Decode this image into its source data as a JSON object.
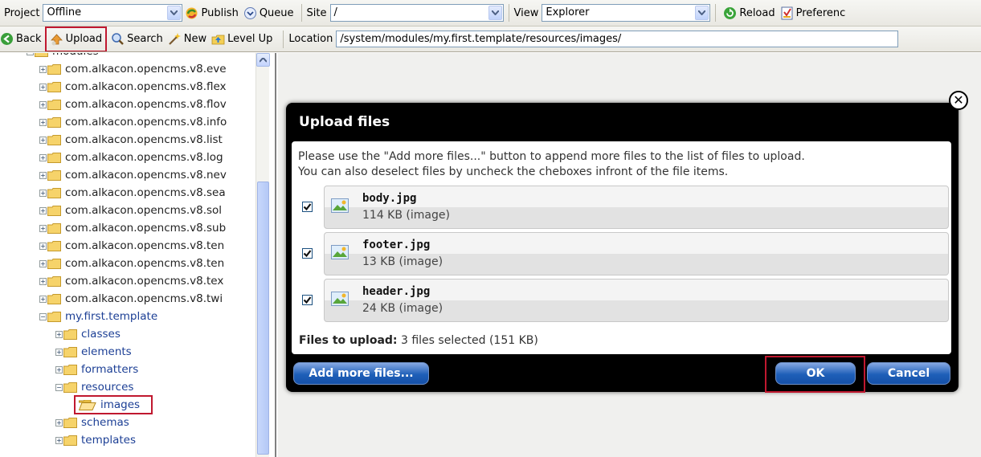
{
  "toolbar1": {
    "project_label": "Project",
    "project_value": "Offline",
    "publish_label": "Publish",
    "queue_label": "Queue",
    "site_label": "Site",
    "site_value": "/",
    "view_label": "View",
    "view_value": "Explorer",
    "reload_label": "Reload",
    "preferences_label": "Preferenc"
  },
  "toolbar2": {
    "back_label": "Back",
    "upload_label": "Upload",
    "search_label": "Search",
    "new_label": "New",
    "levelup_label": "Level Up",
    "location_label": "Location",
    "location_value": "/system/modules/my.first.template/resources/images/"
  },
  "tree": {
    "root": "modules",
    "modules": [
      "com.alkacon.opencms.v8.eve",
      "com.alkacon.opencms.v8.flex",
      "com.alkacon.opencms.v8.flov",
      "com.alkacon.opencms.v8.info",
      "com.alkacon.opencms.v8.list",
      "com.alkacon.opencms.v8.log",
      "com.alkacon.opencms.v8.nev",
      "com.alkacon.opencms.v8.sea",
      "com.alkacon.opencms.v8.sol",
      "com.alkacon.opencms.v8.sub",
      "com.alkacon.opencms.v8.ten",
      "com.alkacon.opencms.v8.ten",
      "com.alkacon.opencms.v8.tex",
      "com.alkacon.opencms.v8.twi"
    ],
    "template": "my.first.template",
    "template_children": [
      "classes",
      "elements",
      "formatters",
      "resources"
    ],
    "images": "images",
    "after_resources": [
      "schemas",
      "templates"
    ]
  },
  "dialog": {
    "title": "Upload files",
    "intro_line1": "Please use the \"Add more files...\" button to append more files to the list of files to upload.",
    "intro_line2": "You can also deselect files by uncheck the cheboxes infront of the file items.",
    "files": [
      {
        "name": "body.jpg",
        "meta": "114 KB (image)",
        "checked": true
      },
      {
        "name": "footer.jpg",
        "meta": "13 KB (image)",
        "checked": true
      },
      {
        "name": "header.jpg",
        "meta": "24 KB (image)",
        "checked": true
      }
    ],
    "summary_label": "Files to upload:",
    "summary_value": "3 files selected (151 KB)",
    "add_more_label": "Add more files...",
    "ok_label": "OK",
    "cancel_label": "Cancel"
  },
  "colors": {
    "highlight": "#c0182f",
    "dialog_bg": "#000000",
    "button_blue": "#1e5fb8",
    "tree_link": "#1c3f95"
  }
}
